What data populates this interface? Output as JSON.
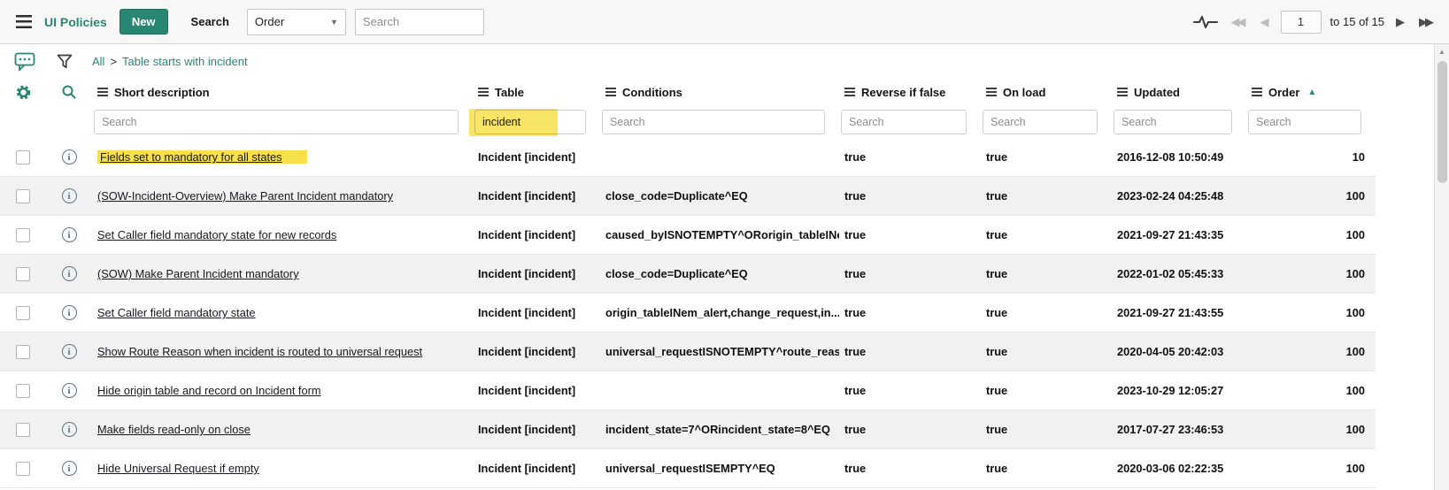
{
  "accent_color": "#278772",
  "highlight_color": "#f7e04a",
  "icons": {
    "first_page": "◀◀",
    "previous_page": "◀",
    "next_page": "▶",
    "last_page": "▶▶",
    "dropdown_caret": "▼",
    "sort_ascending": "▲",
    "scroll_up": "▲"
  },
  "topbar": {
    "title": "UI Policies",
    "new_button": "New",
    "search_label": "Search",
    "search_field_selected": "Order",
    "search_placeholder": "Search",
    "pagination": {
      "page": "1",
      "range": "to 15 of 15"
    }
  },
  "breadcrumb": {
    "root": "All",
    "separator": ">",
    "filter": "Table starts with incident"
  },
  "table": {
    "headers": [
      {
        "label": "Short description"
      },
      {
        "label": "Table"
      },
      {
        "label": "Conditions"
      },
      {
        "label": "Reverse if false"
      },
      {
        "label": "On load"
      },
      {
        "label": "Updated"
      },
      {
        "label": "Order",
        "sorted": "asc"
      }
    ],
    "search_row": {
      "placeholder": "Search",
      "values": {
        "short_description": "",
        "table": "incident",
        "conditions": "",
        "reverse_if_false": "",
        "on_load": "",
        "updated": "",
        "order": ""
      }
    },
    "rows": [
      {
        "short_description": "Fields set to mandatory for all states",
        "table": "Incident [incident]",
        "conditions": "",
        "reverse_if_false": "true",
        "on_load": "true",
        "updated": "2016-12-08 10:50:49",
        "order": "10",
        "highlighted": true
      },
      {
        "short_description": "(SOW-Incident-Overview) Make Parent Incident mandatory",
        "table": "Incident [incident]",
        "conditions": "close_code=Duplicate^EQ",
        "reverse_if_false": "true",
        "on_load": "true",
        "updated": "2023-02-24 04:25:48",
        "order": "100"
      },
      {
        "short_description": "Set Caller field mandatory state for new records",
        "table": "Incident [incident]",
        "conditions": "caused_byISNOTEMPTY^ORorigin_tableINem_a...",
        "reverse_if_false": "true",
        "on_load": "true",
        "updated": "2021-09-27 21:43:35",
        "order": "100"
      },
      {
        "short_description": "(SOW) Make Parent Incident mandatory",
        "table": "Incident [incident]",
        "conditions": "close_code=Duplicate^EQ",
        "reverse_if_false": "true",
        "on_load": "true",
        "updated": "2022-01-02 05:45:33",
        "order": "100"
      },
      {
        "short_description": "Set Caller field mandatory state",
        "table": "Incident [incident]",
        "conditions": "origin_tableINem_alert,change_request,in...",
        "reverse_if_false": "true",
        "on_load": "true",
        "updated": "2021-09-27 21:43:55",
        "order": "100"
      },
      {
        "short_description": "Show Route Reason when incident is routed to universal request",
        "table": "Incident [incident]",
        "conditions": "universal_requestISNOTEMPTY^route_reason...",
        "reverse_if_false": "true",
        "on_load": "true",
        "updated": "2020-04-05 20:42:03",
        "order": "100"
      },
      {
        "short_description": "Hide origin table and record on Incident form",
        "table": "Incident [incident]",
        "conditions": "",
        "reverse_if_false": "true",
        "on_load": "true",
        "updated": "2023-10-29 12:05:27",
        "order": "100"
      },
      {
        "short_description": "Make fields read-only on close",
        "table": "Incident [incident]",
        "conditions": "incident_state=7^ORincident_state=8^EQ",
        "reverse_if_false": "true",
        "on_load": "true",
        "updated": "2017-07-27 23:46:53",
        "order": "100"
      },
      {
        "short_description": "Hide Universal Request if empty",
        "table": "Incident [incident]",
        "conditions": "universal_requestISEMPTY^EQ",
        "reverse_if_false": "true",
        "on_load": "true",
        "updated": "2020-03-06 02:22:35",
        "order": "100"
      }
    ]
  }
}
